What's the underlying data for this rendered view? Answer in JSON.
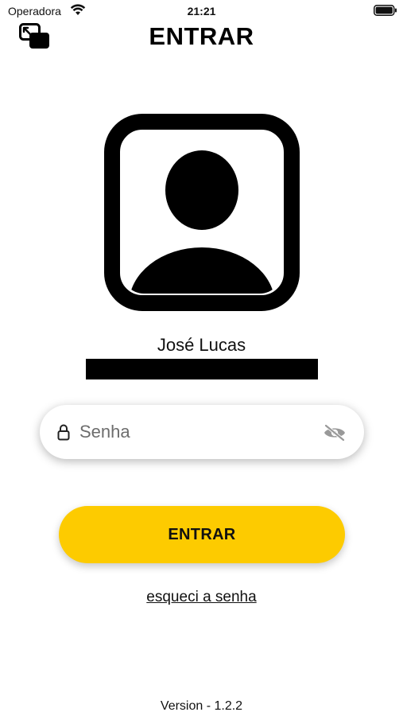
{
  "status_bar": {
    "carrier": "Operadora",
    "time": "21:21",
    "wifi_icon": "wifi-icon",
    "battery_icon": "battery-icon"
  },
  "nav": {
    "title": "ENTRAR",
    "switch_icon": "window-switch-icon"
  },
  "profile": {
    "avatar_icon": "user-avatar-icon",
    "name": "José Lucas"
  },
  "login_form": {
    "password_placeholder": "Senha",
    "password_value": "",
    "lock_icon": "lock-icon",
    "visibility_icon": "eye-slash-icon",
    "submit_label": "ENTRAR",
    "forgot_label": "esqueci a senha"
  },
  "footer": {
    "version": "Version - 1.2.2"
  },
  "colors": {
    "accent": "#fdcb00",
    "background": "#ffffff",
    "text": "#111111"
  }
}
